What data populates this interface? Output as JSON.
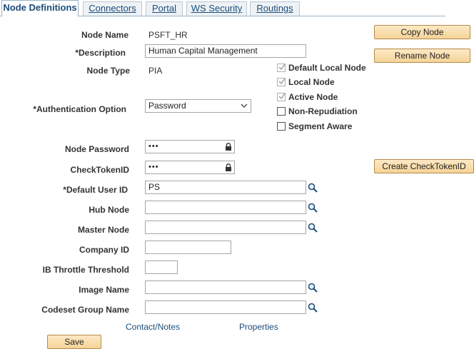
{
  "tabs": [
    {
      "label": "Node Definitions"
    },
    {
      "label": "Connectors"
    },
    {
      "label": "Portal"
    },
    {
      "label": "WS Security"
    },
    {
      "label": "Routings"
    }
  ],
  "form": {
    "node_name": {
      "label": "Node Name",
      "value": "PSFT_HR"
    },
    "description": {
      "label": "*Description",
      "value": "Human Capital Management"
    },
    "node_type": {
      "label": "Node Type",
      "value": "PIA"
    },
    "auth_option": {
      "label": "*Authentication Option",
      "value": "Password"
    },
    "node_password": {
      "label": "Node Password",
      "value": "•••"
    },
    "checktoken": {
      "label": "CheckTokenID",
      "value": "•••"
    },
    "default_user": {
      "label": "*Default User ID",
      "value": "PS"
    },
    "hub_node": {
      "label": "Hub Node",
      "value": ""
    },
    "master_node": {
      "label": "Master Node",
      "value": ""
    },
    "company_id": {
      "label": "Company ID",
      "value": ""
    },
    "ib_throttle": {
      "label": "IB Throttle Threshold",
      "value": ""
    },
    "image_name": {
      "label": "Image Name",
      "value": ""
    },
    "codeset_group": {
      "label": "Codeset Group Name",
      "value": ""
    }
  },
  "checkboxes": [
    {
      "label": "Default Local Node",
      "checked": true,
      "disabled": true
    },
    {
      "label": "Local Node",
      "checked": true,
      "disabled": true
    },
    {
      "label": "Active Node",
      "checked": true,
      "disabled": true
    },
    {
      "label": "Non-Repudiation",
      "checked": false,
      "disabled": false
    },
    {
      "label": "Segment Aware",
      "checked": false,
      "disabled": false
    }
  ],
  "buttons": {
    "copy_node": "Copy Node",
    "rename_node": "Rename Node",
    "create_checktoken": "Create CheckTokenID",
    "save": "Save"
  },
  "links": {
    "contact_notes": "Contact/Notes",
    "properties": "Properties"
  },
  "icons": {
    "lookup": "magnifier-icon",
    "lock": "lock-icon",
    "dropdown": "chevron-down-icon",
    "check": "checkmark-icon"
  }
}
